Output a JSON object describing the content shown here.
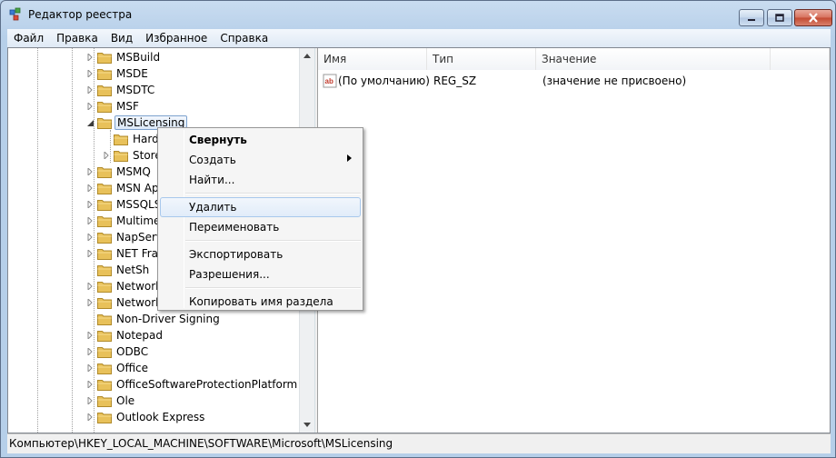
{
  "window": {
    "title": "Редактор реестра"
  },
  "menu": [
    "Файл",
    "Правка",
    "Вид",
    "Избранное",
    "Справка"
  ],
  "tree": {
    "items": [
      {
        "label": "MSBuild",
        "expander": "closed",
        "indent": 1
      },
      {
        "label": "MSDE",
        "expander": "closed",
        "indent": 1
      },
      {
        "label": "MSDTC",
        "expander": "closed",
        "indent": 1
      },
      {
        "label": "MSF",
        "expander": "closed",
        "indent": 1
      },
      {
        "label": "MSLicensing",
        "expander": "open",
        "indent": 1,
        "selected": true
      },
      {
        "label": "Hard",
        "expander": "none",
        "indent": 2
      },
      {
        "label": "Store",
        "expander": "closed",
        "indent": 2
      },
      {
        "label": "MSMQ",
        "expander": "closed",
        "indent": 1
      },
      {
        "label": "MSN Ap",
        "expander": "closed",
        "indent": 1
      },
      {
        "label": "MSSQLS",
        "expander": "closed",
        "indent": 1
      },
      {
        "label": "Multime",
        "expander": "closed",
        "indent": 1
      },
      {
        "label": "NapServ",
        "expander": "closed",
        "indent": 1
      },
      {
        "label": "NET Fran",
        "expander": "closed",
        "indent": 1
      },
      {
        "label": "NetSh",
        "expander": "none",
        "indent": 1
      },
      {
        "label": "Network",
        "expander": "closed",
        "indent": 1
      },
      {
        "label": "Network",
        "expander": "closed",
        "indent": 1
      },
      {
        "label": "Non-Driver Signing",
        "expander": "none",
        "indent": 1
      },
      {
        "label": "Notepad",
        "expander": "closed",
        "indent": 1
      },
      {
        "label": "ODBC",
        "expander": "closed",
        "indent": 1
      },
      {
        "label": "Office",
        "expander": "closed",
        "indent": 1
      },
      {
        "label": "OfficeSoftwareProtectionPlatform",
        "expander": "closed",
        "indent": 1
      },
      {
        "label": "Ole",
        "expander": "closed",
        "indent": 1
      },
      {
        "label": "Outlook Express",
        "expander": "closed",
        "indent": 1
      }
    ]
  },
  "list": {
    "columns": [
      "Имя",
      "Тип",
      "Значение"
    ],
    "rows": [
      {
        "name": "(По умолчанию)",
        "type": "REG_SZ",
        "value": "(значение не присвоено)",
        "icon": "string-value-icon"
      }
    ]
  },
  "context_menu": {
    "items": [
      {
        "label": "Свернуть",
        "bold": true
      },
      {
        "label": "Создать",
        "submenu": true
      },
      {
        "label": "Найти..."
      },
      {
        "separator": true
      },
      {
        "label": "Удалить",
        "hover": true
      },
      {
        "label": "Переименовать"
      },
      {
        "separator": true
      },
      {
        "label": "Экспортировать"
      },
      {
        "label": "Разрешения..."
      },
      {
        "separator": true
      },
      {
        "label": "Копировать имя раздела"
      }
    ]
  },
  "status": {
    "path": "Компьютер\\HKEY_LOCAL_MACHINE\\SOFTWARE\\Microsoft\\MSLicensing"
  },
  "colors": {
    "folder": "#e8c15a",
    "selection_border": "#7da2ce",
    "hover_border": "#a8c8ec"
  }
}
